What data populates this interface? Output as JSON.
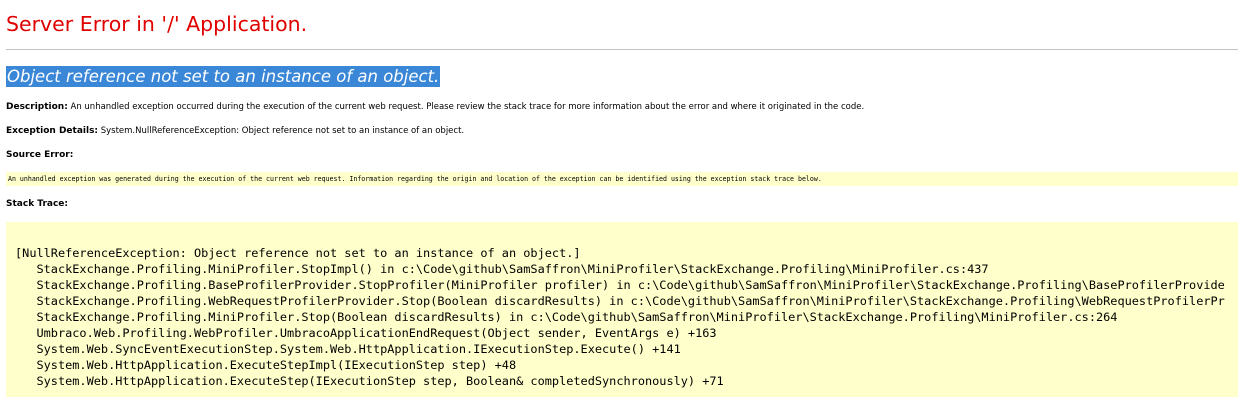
{
  "page": {
    "title": "Server Error in '/' Application.",
    "error_message": "Object reference not set to an instance of an object."
  },
  "description": {
    "label": "Description:",
    "text": "An unhandled exception occurred during the execution of the current web request. Please review the stack trace for more information about the error and where it originated in the code."
  },
  "exception_details": {
    "label": "Exception Details:",
    "text": "System.NullReferenceException: Object reference not set to an instance of an object."
  },
  "source_error": {
    "label": "Source Error:",
    "text": "An unhandled exception was generated during the execution of the current web request. Information regarding the origin and location of the exception can be identified using the exception stack trace below."
  },
  "stack_trace": {
    "label": "Stack Trace:",
    "lines": [
      "[NullReferenceException: Object reference not set to an instance of an object.]",
      "   StackExchange.Profiling.MiniProfiler.StopImpl() in c:\\Code\\github\\SamSaffron\\MiniProfiler\\StackExchange.Profiling\\MiniProfiler.cs:437",
      "   StackExchange.Profiling.BaseProfilerProvider.StopProfiler(MiniProfiler profiler) in c:\\Code\\github\\SamSaffron\\MiniProfiler\\StackExchange.Profiling\\BaseProfilerProvide",
      "   StackExchange.Profiling.WebRequestProfilerProvider.Stop(Boolean discardResults) in c:\\Code\\github\\SamSaffron\\MiniProfiler\\StackExchange.Profiling\\WebRequestProfilerPr",
      "   StackExchange.Profiling.MiniProfiler.Stop(Boolean discardResults) in c:\\Code\\github\\SamSaffron\\MiniProfiler\\StackExchange.Profiling\\MiniProfiler.cs:264",
      "   Umbraco.Web.Profiling.WebProfiler.UmbracoApplicationEndRequest(Object sender, EventArgs e) +163",
      "   System.Web.SyncEventExecutionStep.System.Web.HttpApplication.IExecutionStep.Execute() +141",
      "   System.Web.HttpApplication.ExecuteStepImpl(IExecutionStep step) +48",
      "   System.Web.HttpApplication.ExecuteStep(IExecutionStep step, Boolean& completedSynchronously) +71"
    ]
  },
  "colors": {
    "title": "#e00000",
    "selection_highlight": "#3a87d8",
    "code_background": "#ffffcc"
  }
}
